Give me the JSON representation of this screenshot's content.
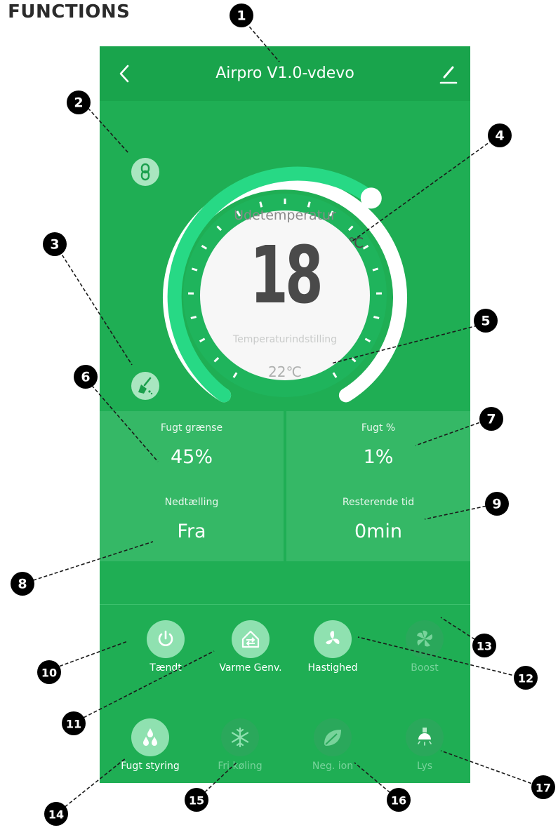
{
  "doc_title": "P FUNCTIONS",
  "header": {
    "title": "Airpro V1.0-vdevo"
  },
  "dial": {
    "label": "Udetemperatur",
    "temperature": "18",
    "unit": "℃",
    "setting_label": "Temperaturindstilling",
    "setting_value": "22℃"
  },
  "cells": {
    "fugt_graense": {
      "label": "Fugt grænse",
      "value": "45%"
    },
    "fugt_pct": {
      "label": "Fugt %",
      "value": "1%"
    },
    "nedtaelling": {
      "label": "Nedtælling",
      "value": "Fra"
    },
    "resterende": {
      "label": "Resterende tid",
      "value": "0min"
    }
  },
  "buttons": {
    "taendt": {
      "label": "Tændt",
      "icon": "power-icon",
      "active": true
    },
    "varme": {
      "label": "Varme Genv.",
      "icon": "heat-recovery-icon",
      "active": true
    },
    "hastighed": {
      "label": "Hastighed",
      "icon": "fan-icon",
      "active": true
    },
    "boost": {
      "label": "Boost",
      "icon": "boost-fan-icon",
      "active": false
    },
    "fugt_styring": {
      "label": "Fugt styring",
      "icon": "droplets-icon",
      "active": true
    },
    "fri_koeling": {
      "label": "Fri køling",
      "icon": "snowflake-icon",
      "active": false
    },
    "neg_ion": {
      "label": "Neg. ion",
      "icon": "leaf-icon",
      "active": false
    },
    "lys": {
      "label": "Lys",
      "icon": "light-bulb-icon",
      "active": false
    }
  },
  "callouts": [
    "1",
    "2",
    "3",
    "4",
    "5",
    "6",
    "7",
    "8",
    "9",
    "10",
    "11",
    "12",
    "13",
    "14",
    "15",
    "16",
    "17"
  ],
  "colors": {
    "background": "#1fae54",
    "header": "#19a44c",
    "cell": "#35b866",
    "active_circle": "#8fe1b0",
    "marker": "#000000"
  }
}
